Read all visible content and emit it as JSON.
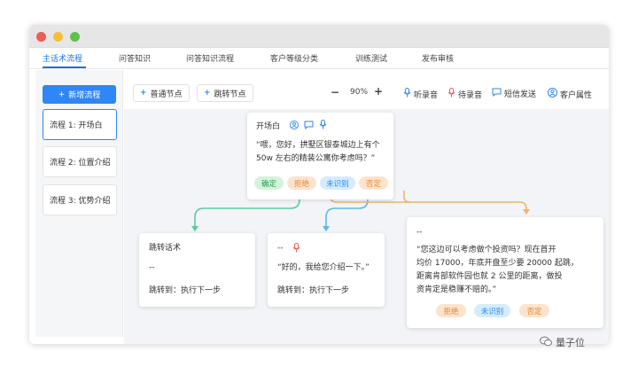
{
  "tabs": [
    "主话术流程",
    "问答知识",
    "问答知识流程",
    "客户等级分类",
    "训练测试",
    "发布审核"
  ],
  "sidebar": {
    "add_label": "新增流程",
    "flows": [
      "流程 1: 开场白",
      "流程 2: 位置介绍",
      "流程 3: 优势介绍"
    ]
  },
  "toolbar": {
    "normal_node": "普通节点",
    "jump_node": "跳转节点",
    "zoom": "90%",
    "listen": "听录音",
    "pending": "待录音",
    "sms": "短信发送",
    "customer_attr": "客户属性"
  },
  "nodes": {
    "opening": {
      "title": "开场白",
      "text_line1": "“喂，您好，拱墅区银泰城边上有个",
      "text_line2": "50w 左右的精装公寓你考虑吗？”",
      "tags": [
        "确定",
        "拒绝",
        "未识别",
        "否定"
      ]
    },
    "jump": {
      "title": "跳转话术",
      "dash": "--",
      "jump_to": "跳转到：执行下一步"
    },
    "reply": {
      "dash": "--",
      "text": "“好的，我给您介绍一下。”",
      "jump_to": "跳转到：执行下一步"
    },
    "invest": {
      "dash": "--",
      "line1": "“您这边可以考虑做个投资吗？现在首开",
      "line2": "均价 17000，年底开盘至少要 20000 起跳，",
      "line3": "距离肯部软件园也就 2 公里的距离，做投",
      "line4": "资肯定是稳赚不赔的。”",
      "tags": [
        "拒绝",
        "未识别",
        "否定"
      ]
    }
  },
  "watermark": "量子位",
  "colors": {
    "accent": "#2f86f6",
    "green": "#5cc9a0",
    "blue_line": "#5bb8e8",
    "orange_line": "#f0b36c"
  }
}
